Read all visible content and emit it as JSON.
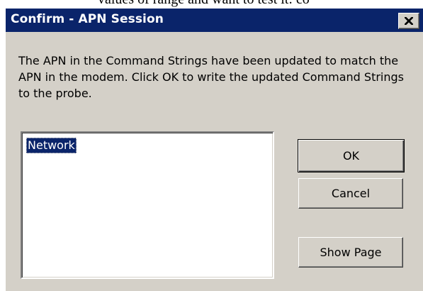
{
  "background_fragment": "values of range and want to test it: co",
  "dialog": {
    "title": "Confirm - APN Session",
    "message": "The APN in the Command Strings have been updated to match the APN in the modem. Click OK to write the updated Command Strings to the probe.",
    "list_items": [
      "Network"
    ],
    "selected_item": "Network",
    "buttons": {
      "ok": "OK",
      "cancel": "Cancel",
      "show_page": "Show Page"
    }
  },
  "icons": {
    "close": "close-icon"
  },
  "colors": {
    "titlebar": "#0a246a",
    "face": "#d4d0c8",
    "selection": "#0a246a"
  }
}
